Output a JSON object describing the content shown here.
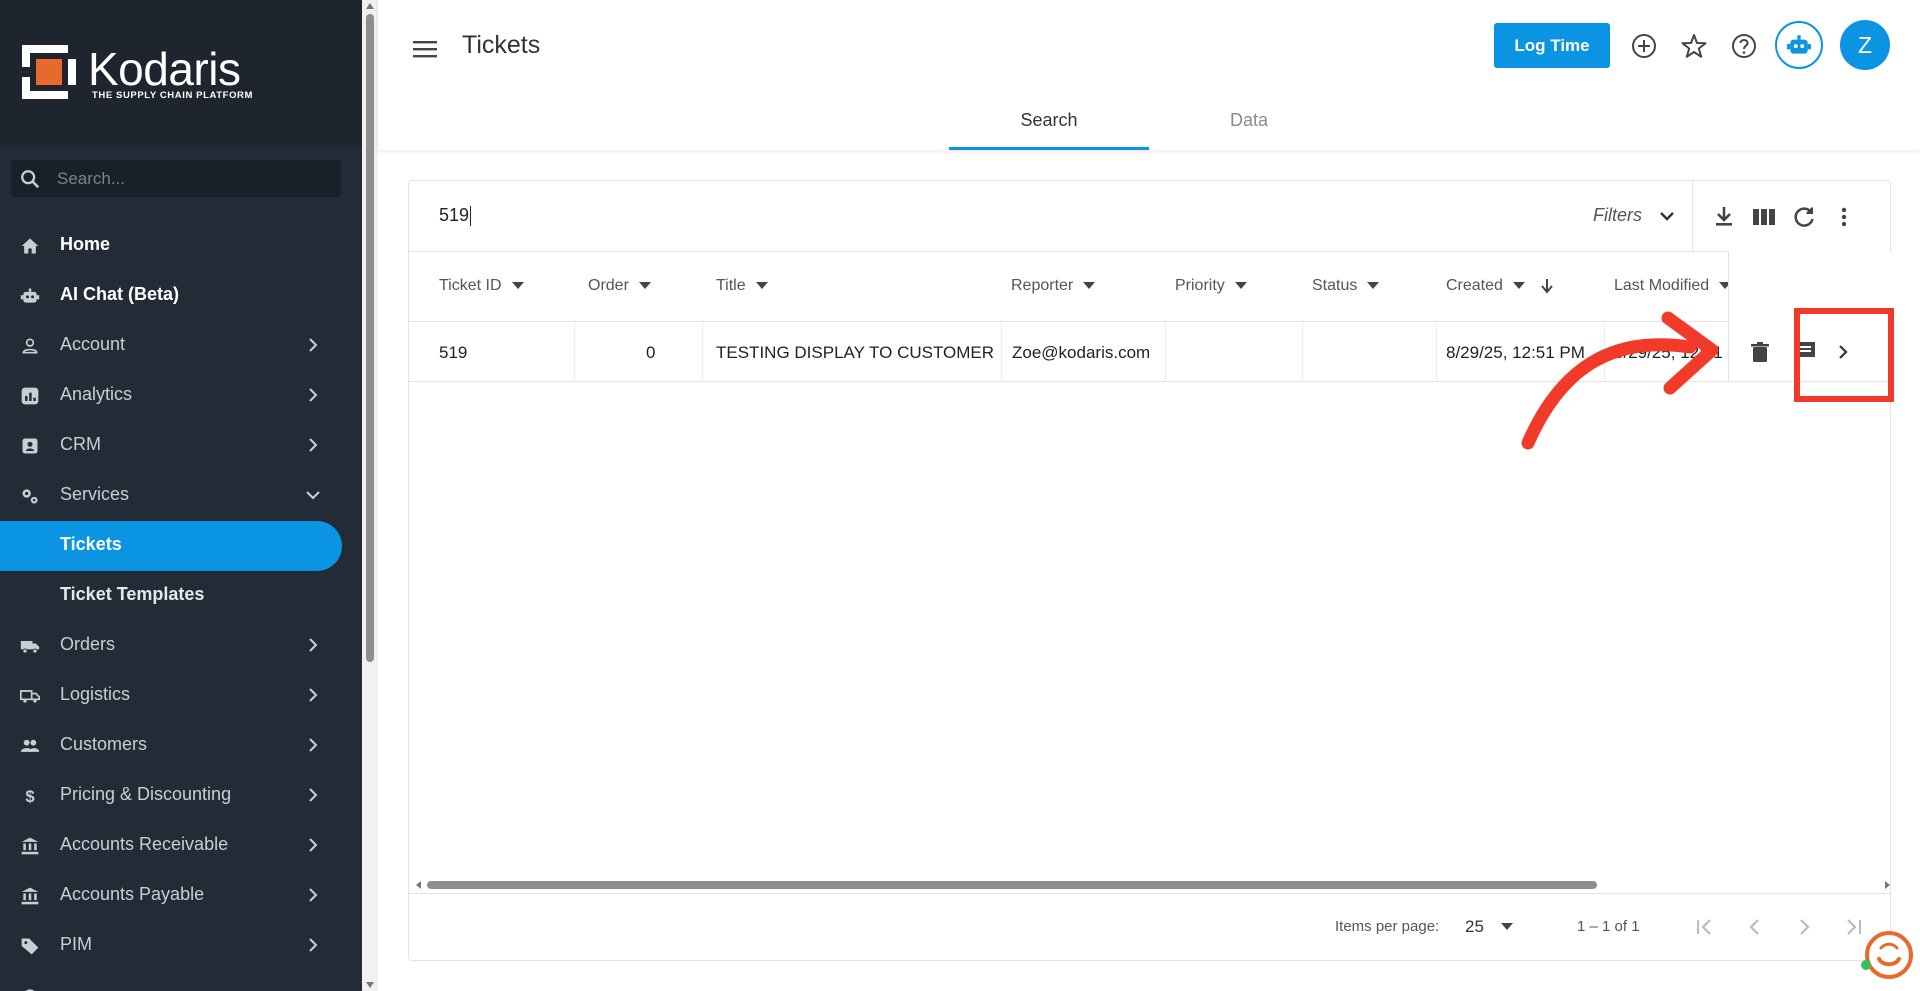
{
  "brand": {
    "name": "Kodaris",
    "tagline": "THE SUPPLY CHAIN PLATFORM",
    "accent": "#0a94e2",
    "logo_orange": "#e8692d"
  },
  "sidebar": {
    "search_placeholder": "Search...",
    "items": [
      {
        "label": "Home",
        "icon": "home-icon"
      },
      {
        "label": "AI Chat (Beta)",
        "icon": "robot-icon"
      },
      {
        "label": "Account",
        "icon": "person-icon"
      },
      {
        "label": "Analytics",
        "icon": "analytics-icon"
      },
      {
        "label": "CRM",
        "icon": "contact-card-icon"
      },
      {
        "label": "Services",
        "icon": "gears-icon"
      },
      {
        "label": "Tickets",
        "icon": ""
      },
      {
        "label": "Ticket Templates",
        "icon": ""
      },
      {
        "label": "Orders",
        "icon": "truck-icon"
      },
      {
        "label": "Logistics",
        "icon": "delivery-truck-icon"
      },
      {
        "label": "Customers",
        "icon": "people-icon"
      },
      {
        "label": "Pricing & Discounting",
        "icon": "dollar-icon"
      },
      {
        "label": "Accounts Receivable",
        "icon": "bank-icon"
      },
      {
        "label": "Accounts Payable",
        "icon": "bank-icon"
      },
      {
        "label": "PIM",
        "icon": "tag-icon"
      }
    ]
  },
  "header": {
    "title": "Tickets",
    "log_time_label": "Log Time",
    "avatar_initial": "Z",
    "tabs": [
      {
        "label": "Search",
        "active": true
      },
      {
        "label": "Data",
        "active": false
      }
    ]
  },
  "search": {
    "value": "519",
    "filters_label": "Filters"
  },
  "table": {
    "columns": [
      "Ticket ID",
      "Order",
      "Title",
      "Reporter",
      "Priority",
      "Status",
      "Created",
      "Last Modified"
    ],
    "rows": [
      {
        "ticket_id": "519",
        "order": "0",
        "title": "TESTING DISPLAY TO CUSTOMER",
        "reporter": "Zoe@kodaris.com",
        "priority": "",
        "status": "",
        "created": "8/29/25, 12:51 PM",
        "last_modified": "8/29/25, 12:51 PM"
      }
    ]
  },
  "pagination": {
    "items_per_page_label": "Items per page:",
    "items_per_page": "25",
    "range_label": "1 – 1 of 1"
  },
  "annotation": {
    "color": "#f23a2a"
  }
}
